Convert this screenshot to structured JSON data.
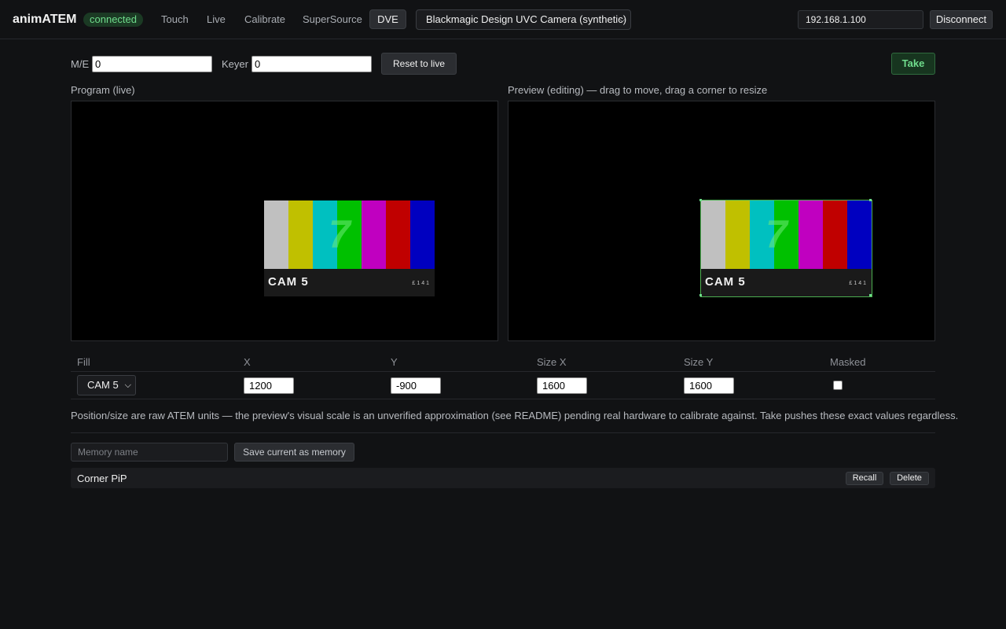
{
  "app": {
    "title": "animATEM",
    "status": "connected"
  },
  "nav": {
    "items": [
      {
        "label": "Touch"
      },
      {
        "label": "Live"
      },
      {
        "label": "Calibrate"
      },
      {
        "label": "SuperSource"
      },
      {
        "label": "DVE",
        "active": true
      }
    ]
  },
  "camera_select": {
    "value": "Blackmagic Design UVC Camera (synthetic)"
  },
  "connection": {
    "ip": "192.168.1.100",
    "disconnect_label": "Disconnect"
  },
  "controls": {
    "me_label": "M/E",
    "me_value": "0",
    "keyer_label": "Keyer",
    "keyer_value": "0",
    "reset_label": "Reset to live",
    "take_label": "Take"
  },
  "program": {
    "label": "Program (live)"
  },
  "preview": {
    "label": "Preview (editing) — drag to move, drag a corner to resize"
  },
  "test_card": {
    "number": "7",
    "camera": "CAM 5",
    "code": "£141",
    "bar_colors": [
      "#c0c0c0",
      "#c0c000",
      "#00c0c0",
      "#00c000",
      "#c000c0",
      "#c00000",
      "#0000c0"
    ]
  },
  "table": {
    "headers": {
      "fill": "Fill",
      "x": "X",
      "y": "Y",
      "size_x": "Size X",
      "size_y": "Size Y",
      "masked": "Masked"
    },
    "row": {
      "fill": "CAM 5",
      "x": "1200",
      "y": "-900",
      "size_x": "1600",
      "size_y": "1600",
      "masked": false
    }
  },
  "note": "Position/size are raw ATEM units — the preview's visual scale is an unverified approximation (see README) pending real hardware to calibrate against. Take pushes these exact values regardless.",
  "memory": {
    "placeholder": "Memory name",
    "save_label": "Save current as memory",
    "items": [
      {
        "name": "Corner PiP",
        "recall_label": "Recall",
        "delete_label": "Delete"
      }
    ]
  },
  "colors": {
    "accent_green": "#6fdc8c",
    "background": "#111214"
  }
}
